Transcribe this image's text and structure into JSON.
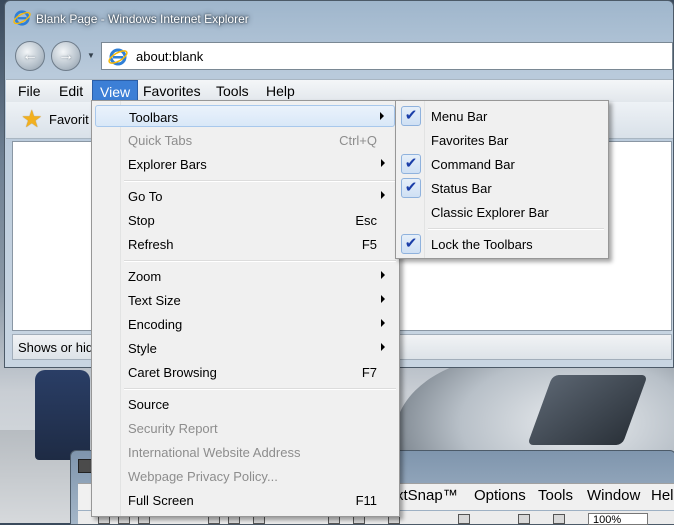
{
  "window": {
    "title": "Blank Page - Windows Internet Explorer",
    "address": "about:blank"
  },
  "menubar": [
    {
      "label": "File"
    },
    {
      "label": "Edit"
    },
    {
      "label": "View"
    },
    {
      "label": "Favorites"
    },
    {
      "label": "Tools"
    },
    {
      "label": "Help"
    }
  ],
  "favbar": {
    "label": "Favorit"
  },
  "status": {
    "text": "Shows or hid"
  },
  "view_menu": {
    "toolbars": "Toolbars",
    "quick_tabs": "Quick Tabs",
    "quick_tabs_shortcut": "Ctrl+Q",
    "explorer_bars": "Explorer Bars",
    "go_to": "Go To",
    "stop": "Stop",
    "stop_shortcut": "Esc",
    "refresh": "Refresh",
    "refresh_shortcut": "F5",
    "zoom": "Zoom",
    "text_size": "Text Size",
    "encoding": "Encoding",
    "style": "Style",
    "caret_browsing": "Caret Browsing",
    "caret_browsing_shortcut": "F7",
    "source": "Source",
    "security_report": "Security Report",
    "intl_address": "International Website Address",
    "privacy_policy": "Webpage Privacy Policy...",
    "full_screen": "Full Screen",
    "full_screen_shortcut": "F11"
  },
  "toolbars_menu": {
    "menu_bar": "Menu Bar",
    "favorites_bar": "Favorites Bar",
    "command_bar": "Command Bar",
    "status_bar": "Status Bar",
    "classic_explorer_bar": "Classic Explorer Bar",
    "lock_toolbars": "Lock the Toolbars",
    "checked": [
      "Menu Bar",
      "Command Bar",
      "Status Bar",
      "Lock the Toolbars"
    ]
  },
  "app2": {
    "menus": [
      "xtSnap™",
      "Options",
      "Tools",
      "Window",
      "Help"
    ],
    "zoom": "100%"
  },
  "icons": {
    "check": "✔",
    "star": "★",
    "back": "←",
    "forward": "→"
  }
}
